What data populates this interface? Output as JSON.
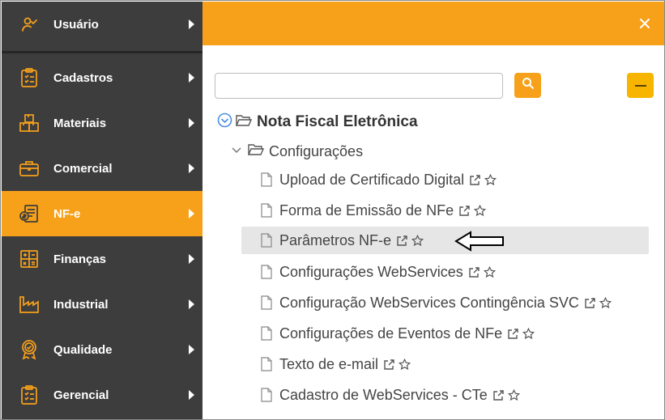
{
  "sidebar": {
    "items": [
      {
        "label": "Usuário",
        "icon": "user-check-icon",
        "active": false
      },
      {
        "label": "Cadastros",
        "icon": "clipboard-list-icon",
        "active": false
      },
      {
        "label": "Materiais",
        "icon": "boxes-icon",
        "active": false
      },
      {
        "label": "Comercial",
        "icon": "briefcase-icon",
        "active": false
      },
      {
        "label": "NF-e",
        "icon": "invoice-icon",
        "active": true
      },
      {
        "label": "Finanças",
        "icon": "calculator-icon",
        "active": false
      },
      {
        "label": "Industrial",
        "icon": "factory-icon",
        "active": false
      },
      {
        "label": "Qualidade",
        "icon": "quality-badge-icon",
        "active": false
      },
      {
        "label": "Gerencial",
        "icon": "clipboard-list-icon",
        "active": false
      }
    ]
  },
  "panel": {
    "search": {
      "value": "",
      "placeholder": ""
    },
    "tree": {
      "root": "Nota Fiscal Eletrônica",
      "group": "Configurações",
      "items": [
        {
          "label": "Upload de Certificado Digital",
          "selected": false
        },
        {
          "label": "Forma de Emissão de NFe",
          "selected": false
        },
        {
          "label": "Parâmetros NF-e",
          "selected": true
        },
        {
          "label": "Configurações WebServices",
          "selected": false
        },
        {
          "label": "Configuração WebServices Contingência SVC",
          "selected": false
        },
        {
          "label": "Configurações de Eventos de NFe",
          "selected": false
        },
        {
          "label": "Texto de e-mail",
          "selected": false
        },
        {
          "label": "Cadastro de WebServices - CTe",
          "selected": false
        }
      ]
    }
  },
  "colors": {
    "accent": "#f7a11a",
    "sidebar_bg": "#3d3d3d",
    "selected_row": "#e6e6e6",
    "tree_icon_blue": "#4a90e2"
  }
}
